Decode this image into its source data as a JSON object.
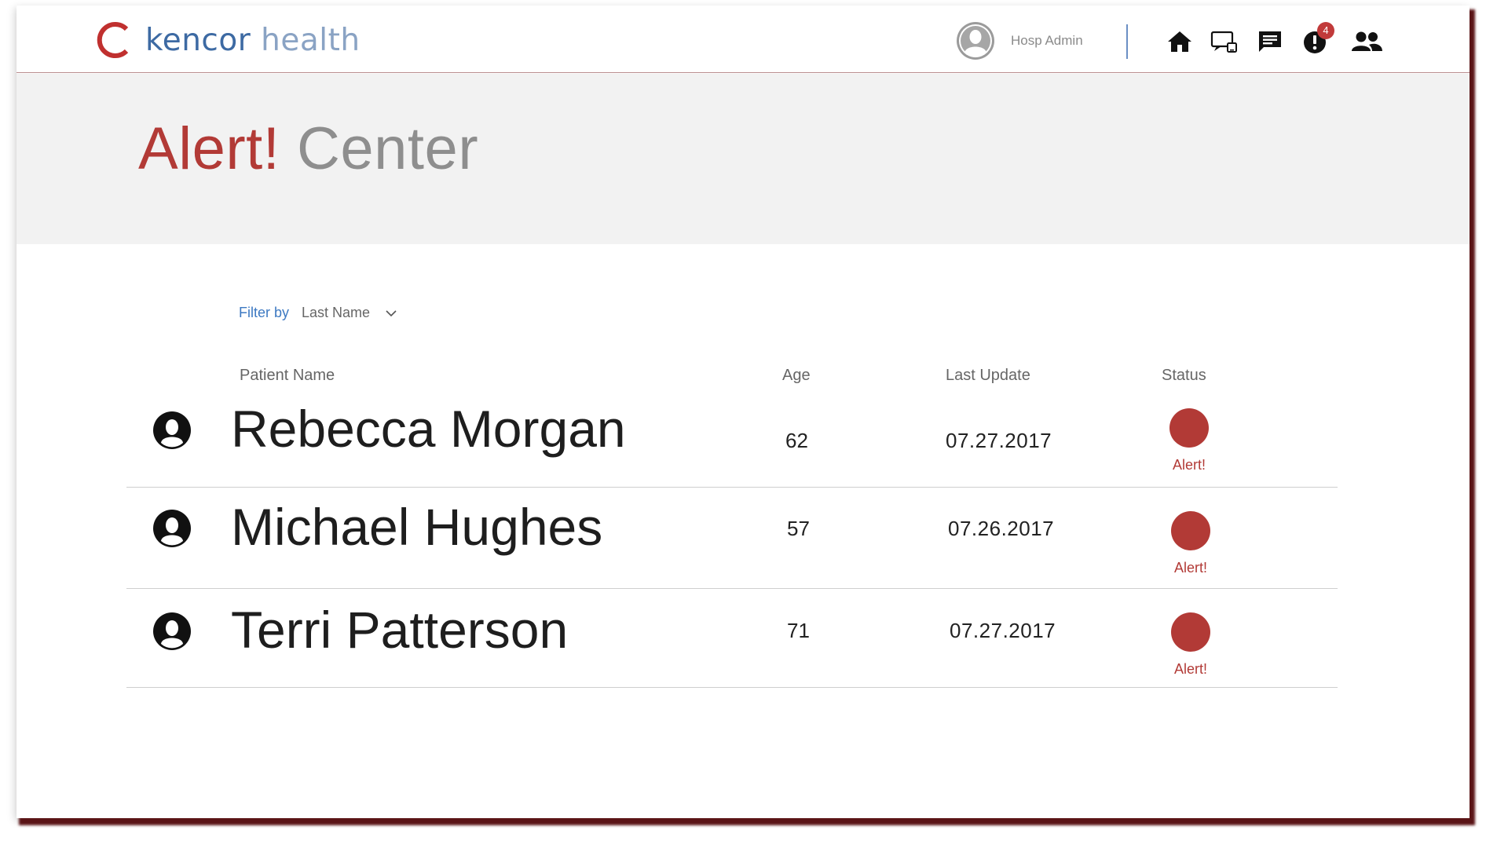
{
  "brand": {
    "name_part1": "ken",
    "name_part2": "cor",
    "name_part3": " health",
    "accent": "#b23a36",
    "blue": "#3d6aa3"
  },
  "header": {
    "user_name": "Hosp Admin",
    "icons": [
      "home-icon",
      "devices-icon",
      "message-icon",
      "alerts-icon",
      "users-icon"
    ],
    "alert_count": "4"
  },
  "hero": {
    "title_red": "Alert!",
    "title_gray": "Center"
  },
  "filter": {
    "label": "Filter by",
    "value": "Last Name"
  },
  "table": {
    "headers": {
      "name": "Patient Name",
      "age": "Age",
      "last_update": "Last Update",
      "status": "Status"
    },
    "rows": [
      {
        "name": "Rebecca Morgan",
        "age": "62",
        "last_update": "07.27.2017",
        "status": "Alert!"
      },
      {
        "name": "Michael Hughes",
        "age": "57",
        "last_update": "07.26.2017",
        "status": "Alert!"
      },
      {
        "name": "Terri Patterson",
        "age": "71",
        "last_update": "07.27.2017",
        "status": "Alert!"
      }
    ]
  }
}
